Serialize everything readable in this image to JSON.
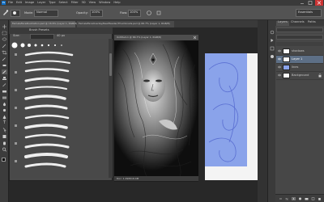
{
  "app": {
    "logo": "Ps"
  },
  "menu": [
    "File",
    "Edit",
    "Image",
    "Layer",
    "Type",
    "Select",
    "Filter",
    "3D",
    "View",
    "Window",
    "Help"
  ],
  "options": {
    "mode_label": "Mode:",
    "mode_value": "Normal",
    "opacity_label": "Opacity:",
    "opacity_value": "100%",
    "flow_label": "Flow:",
    "flow_value": "100%",
    "workspace": "Essentials"
  },
  "tabs": [
    {
      "label": "FemaleFaceIllustration.psd @ 16.6% (Layer 1, RGB/8)"
    },
    {
      "label": "FemaleFaceOverlay/ReelHeader/Thumbnails.psd @ 66.7% (Layer 1, RGB/8)"
    }
  ],
  "brush_panel": {
    "tab_label": "Brush Presets",
    "size_label": "Size:",
    "size_value": "40 px",
    "sample_sizes": [
      "30",
      "30",
      "30",
      "25",
      "25",
      "36",
      "25",
      "36",
      "36",
      "32",
      "25",
      "50",
      "25"
    ]
  },
  "photo_window": {
    "title": "Untitled-1 @ 66.7% (Layer 1, RGB/8)",
    "status": "Doc: 1.49M/16.4M"
  },
  "layers": {
    "tabs": [
      "Layers",
      "Channels",
      "Paths"
    ],
    "rows": [
      {
        "name": "shadows",
        "selected": false
      },
      {
        "name": "Layer 1",
        "selected": true
      },
      {
        "name": "lines",
        "selected": false
      },
      {
        "name": "Background",
        "selected": false
      }
    ]
  },
  "colors": {
    "accent_blue": "#0f6fc6",
    "sketch_blue": "#8aa3ea",
    "selection": "#5d6f86"
  },
  "icons": [
    "photoshop-logo-icon",
    "eye-icon",
    "brush-icon",
    "move-icon",
    "lasso-icon",
    "crop-icon",
    "eraser-icon",
    "text-icon",
    "hand-icon",
    "zoom-icon"
  ]
}
